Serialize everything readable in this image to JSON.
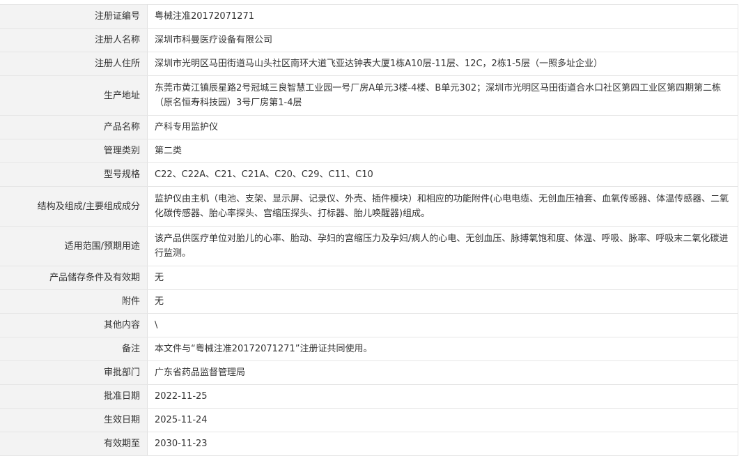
{
  "rows": [
    {
      "label": "注册证编号",
      "value": "粤械注准20172071271"
    },
    {
      "label": "注册人名称",
      "value": "深圳市科曼医疗设备有限公司"
    },
    {
      "label": "注册人住所",
      "value": "深圳市光明区马田街道马山头社区南环大道飞亚达钟表大厦1栋A10层-11层、12C，2栋1-5层（一照多址企业）"
    },
    {
      "label": "生产地址",
      "value": "东莞市黄江镇辰星路2号冠城三良智慧工业园一号厂房A单元3楼-4楼、B单元302；深圳市光明区马田街道合水口社区第四工业区第四期第二栋（原名恒寿科技园）3号厂房第1-4层"
    },
    {
      "label": "产品名称",
      "value": "产科专用监护仪"
    },
    {
      "label": "管理类别",
      "value": "第二类"
    },
    {
      "label": "型号规格",
      "value": "C22、C22A、C21、C21A、C20、C29、C11、C10"
    },
    {
      "label": "结构及组成/主要组成成分",
      "value": "监护仪由主机（电池、支架、显示屏、记录仪、外壳、插件模块）和相应的功能附件(心电电缆、无创血压袖套、血氧传感器、体温传感器、二氧化碳传感器、胎心率探头、宫缩压探头、打标器、胎儿唤醒器)组成。"
    },
    {
      "label": "适用范围/预期用途",
      "value": "该产品供医疗单位对胎儿的心率、胎动、孕妇的宫缩压力及孕妇/病人的心电、无创血压、脉搏氧饱和度、体温、呼吸、脉率、呼吸末二氧化碳进行监测。"
    },
    {
      "label": "产品储存条件及有效期",
      "value": "无"
    },
    {
      "label": "附件",
      "value": "无"
    },
    {
      "label": "其他内容",
      "value": "\\"
    },
    {
      "label": "备注",
      "value": "本文件与“粤械注准20172071271”注册证共同使用。"
    },
    {
      "label": "审批部门",
      "value": "广东省药品监督管理局"
    },
    {
      "label": "批准日期",
      "value": "2022-11-25"
    },
    {
      "label": "生效日期",
      "value": "2025-11-24"
    },
    {
      "label": "有效期至",
      "value": "2030-11-23"
    }
  ]
}
